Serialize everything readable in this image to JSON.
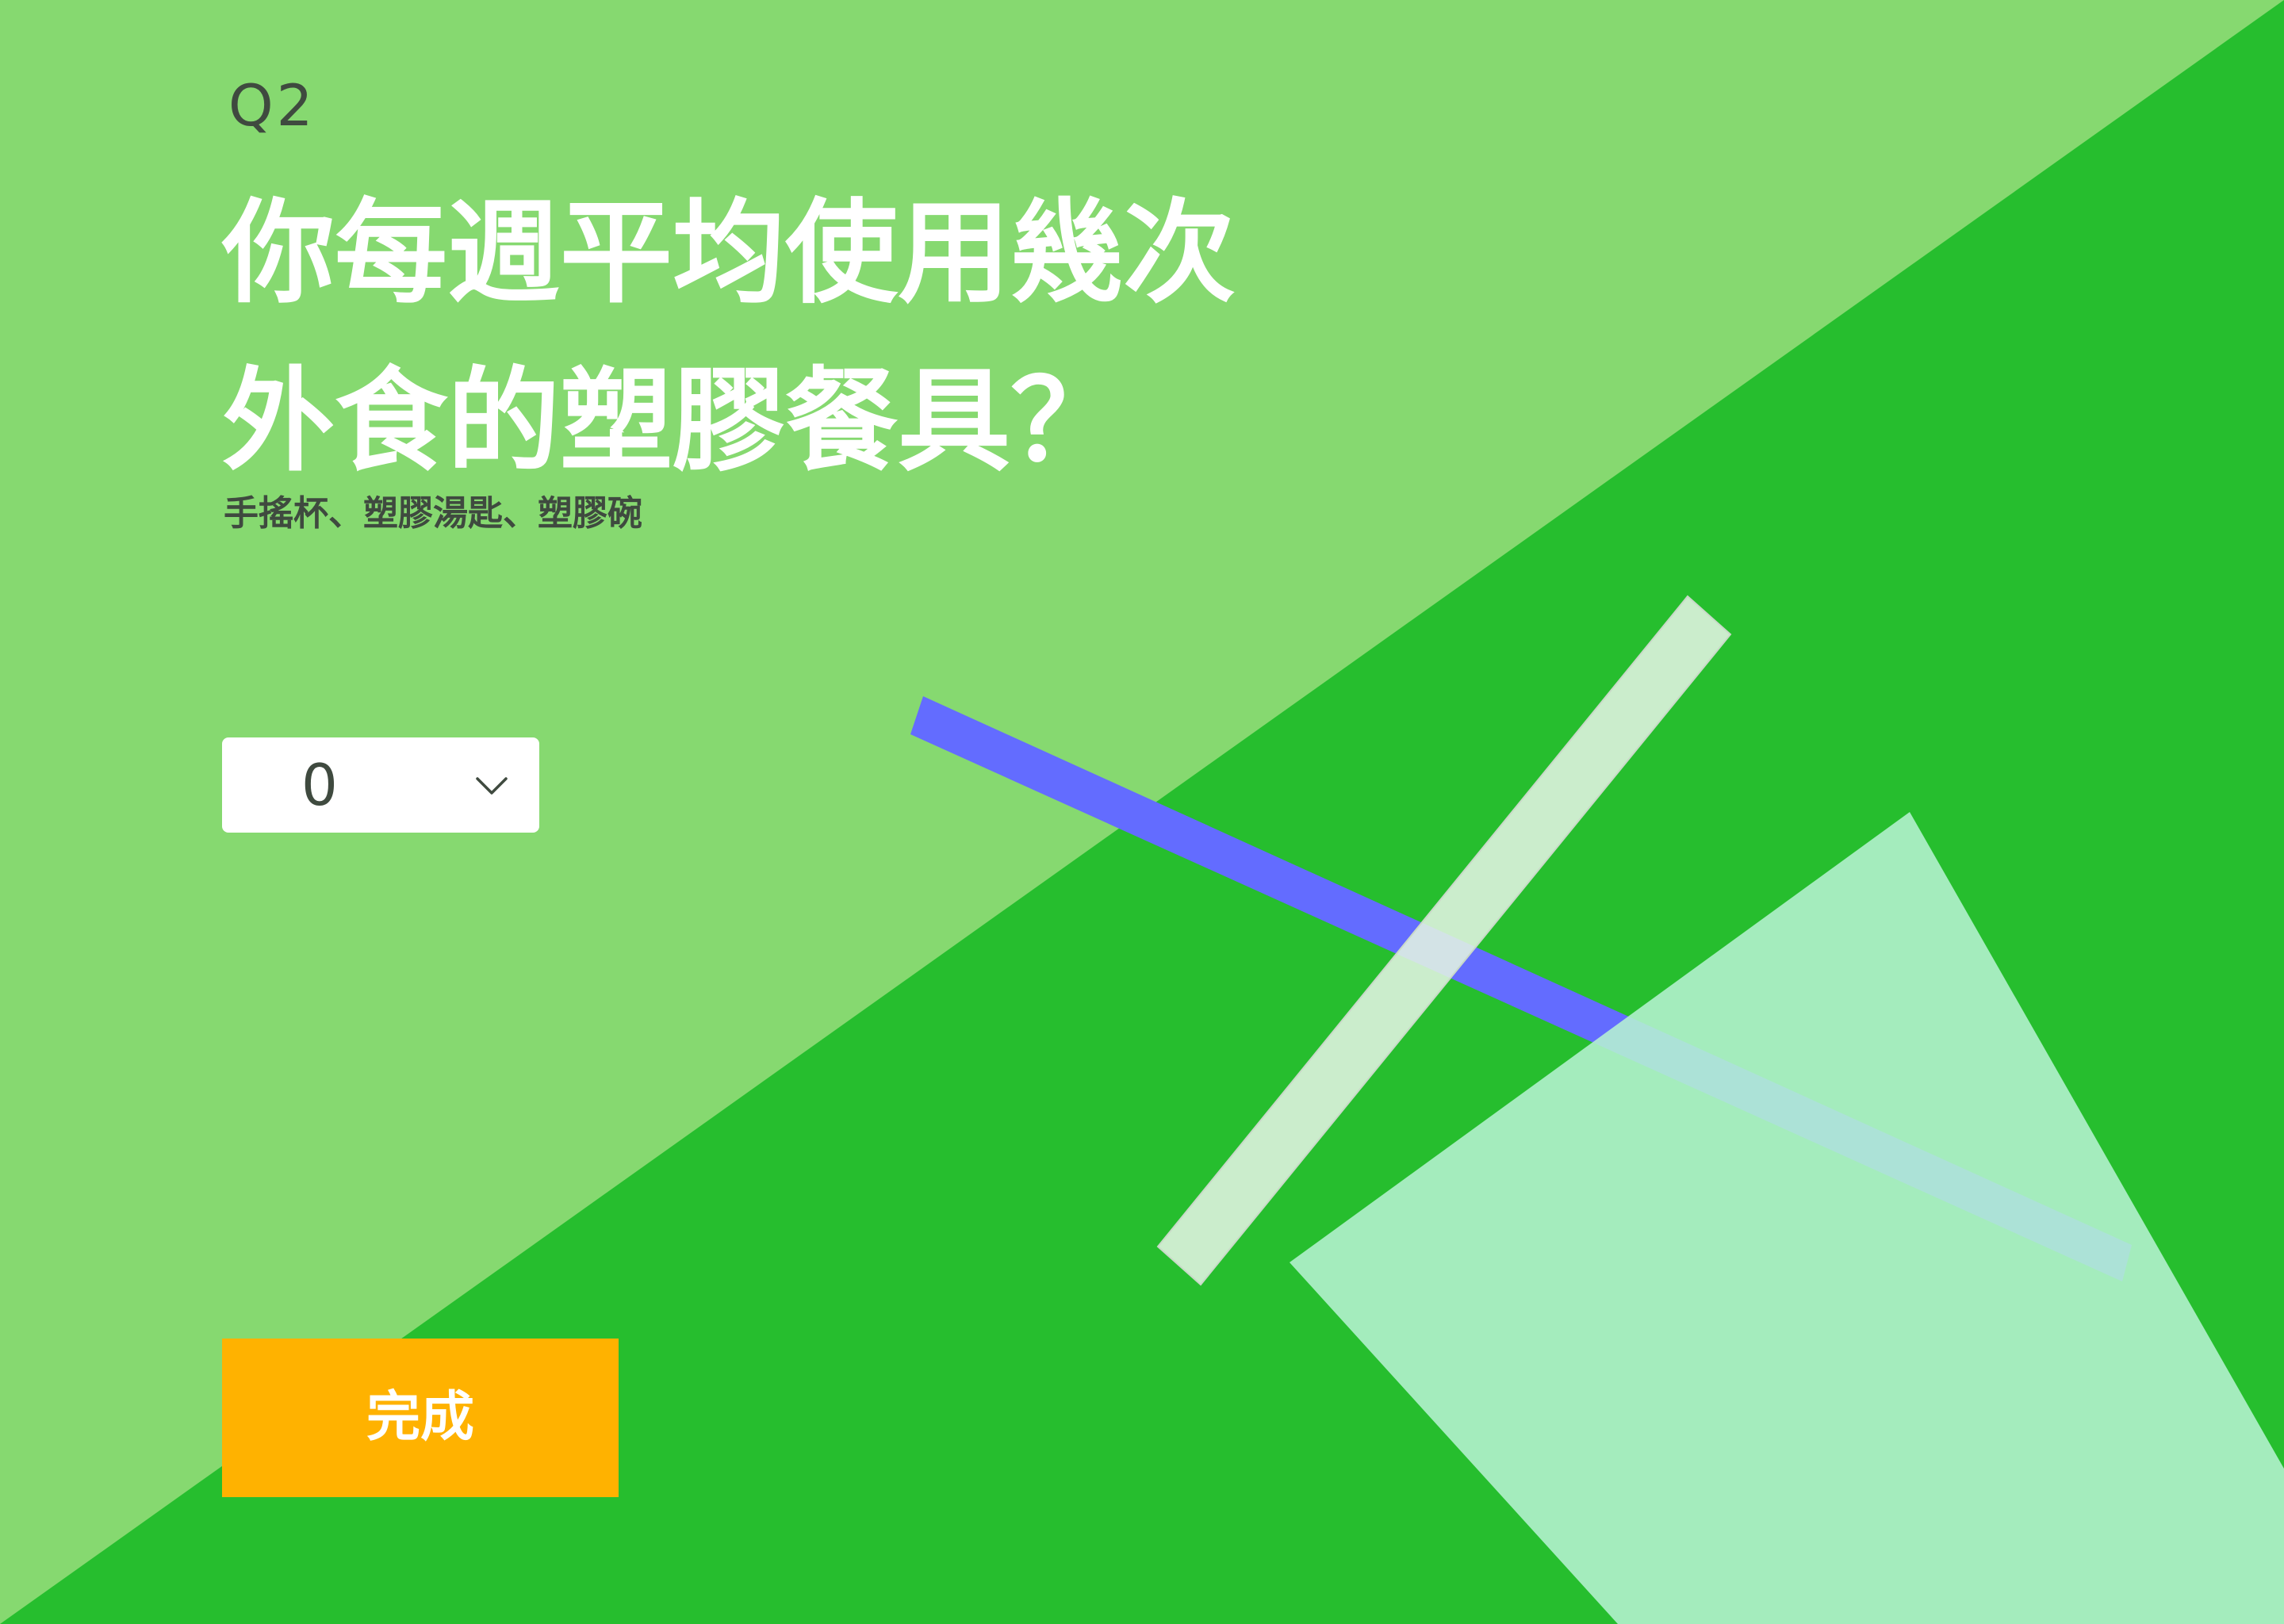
{
  "question": {
    "number": "Q2",
    "title_lines": [
      "你每週平均使用幾次",
      "外食的塑膠餐具？"
    ],
    "hint": "手搖杯、塑膠湯匙、塑膠碗"
  },
  "select": {
    "value": "0",
    "icon": "chevron-down-icon"
  },
  "done_button": {
    "label": "完成"
  },
  "colors": {
    "light_green": "#86d970",
    "dark_green": "#26be2e",
    "blue_bar": "#636cff",
    "white_bar": "#e3f4e2",
    "mint_shape": "#b6f2d1",
    "button": "#ffb200",
    "text_dark": "#3f4a3f",
    "text_light": "#ffffff"
  }
}
